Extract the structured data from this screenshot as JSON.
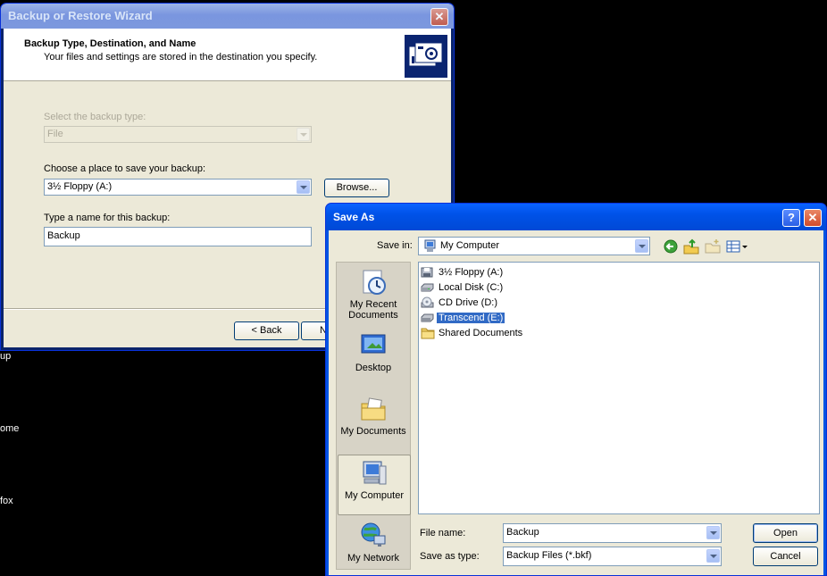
{
  "desktop": {
    "fragments": [
      "up",
      "ome",
      "fox"
    ]
  },
  "wizard": {
    "title": "Backup or Restore Wizard",
    "close_glyph": "✕",
    "header_title": "Backup Type, Destination, and Name",
    "header_subtitle": "Your files and settings are stored in the destination you specify.",
    "backup_type_label": "Select the backup type:",
    "backup_type_value": "File",
    "destination_label": "Choose a place to save your backup:",
    "destination_value": "3½ Floppy (A:)",
    "browse_label": "Browse...",
    "name_label": "Type a name for this backup:",
    "name_value": "Backup",
    "back_label": "< Back",
    "next_label_visible": "N"
  },
  "save_as": {
    "title": "Save As",
    "help_glyph": "?",
    "close_glyph": "✕",
    "save_in_label": "Save in:",
    "save_in_value": "My Computer",
    "places": [
      {
        "label": "My Recent Documents",
        "icon": "recent-documents-icon"
      },
      {
        "label": "Desktop",
        "icon": "desktop-icon"
      },
      {
        "label": "My Documents",
        "icon": "my-documents-icon"
      },
      {
        "label": "My Computer",
        "icon": "my-computer-icon",
        "selected": true
      },
      {
        "label": "My Network",
        "icon": "my-network-icon"
      }
    ],
    "files": [
      {
        "label": "3½ Floppy (A:)",
        "icon": "floppy-drive-icon"
      },
      {
        "label": "Local Disk (C:)",
        "icon": "hard-disk-icon"
      },
      {
        "label": "CD Drive (D:)",
        "icon": "cd-drive-icon"
      },
      {
        "label": "Transcend (E:)",
        "icon": "removable-drive-icon",
        "selected": true
      },
      {
        "label": "Shared Documents",
        "icon": "folder-icon"
      }
    ],
    "file_name_label": "File name:",
    "file_name_value": "Backup",
    "save_as_type_label": "Save as type:",
    "save_as_type_value": "Backup Files (*.bkf)",
    "open_label": "Open",
    "cancel_label": "Cancel"
  },
  "colors": {
    "selection": "#316ac5",
    "active_titlebar": "#0054e3",
    "dialog_face": "#ece9d8"
  }
}
